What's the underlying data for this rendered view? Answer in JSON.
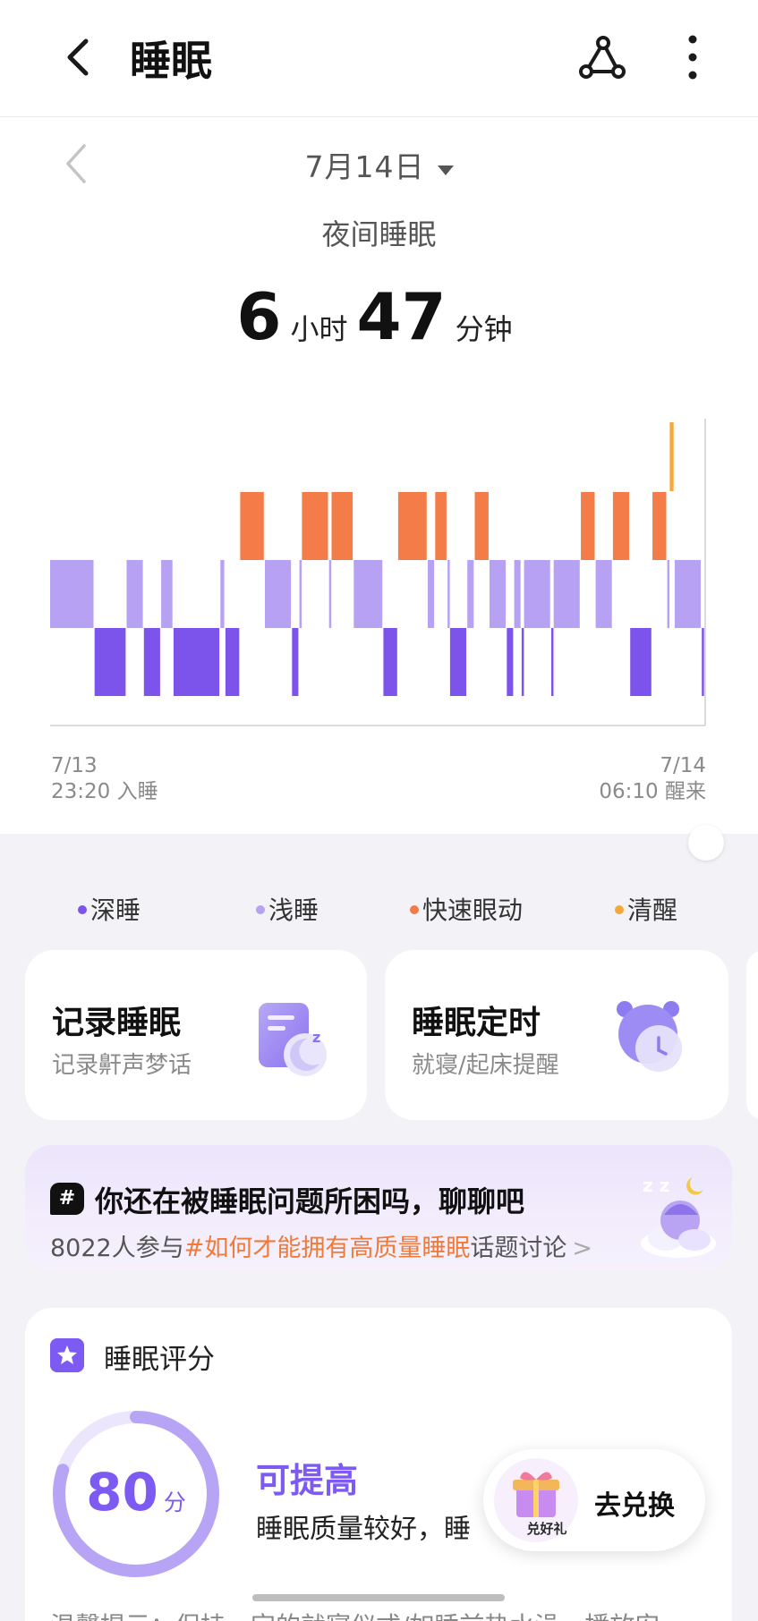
{
  "header": {
    "title": "睡眠",
    "back_icon": "back-arrow-icon",
    "share_icon": "share-icon",
    "more_icon": "more-vertical-icon"
  },
  "date": {
    "label": "7月14日",
    "prev_icon": "chevron-left-icon",
    "dropdown_icon": "caret-down-icon"
  },
  "summary": {
    "subtitle": "夜间睡眠",
    "hours": "6",
    "hours_unit": "小时",
    "minutes": "47",
    "minutes_unit": "分钟"
  },
  "chart_data": {
    "type": "hypnogram",
    "start": {
      "date": "7/13",
      "time_label": "23:20 入睡"
    },
    "end": {
      "date": "7/14",
      "time_label": "06:10 醒来"
    },
    "stages": [
      "awake",
      "rem",
      "light",
      "deep"
    ],
    "segments": [
      {
        "start": "23:20",
        "end": "23:38",
        "stage": "light"
      },
      {
        "start": "23:38",
        "end": "23:51",
        "stage": "deep"
      },
      {
        "start": "23:51",
        "end": "23:58",
        "stage": "light"
      },
      {
        "start": "23:58",
        "end": "00:05",
        "stage": "deep"
      },
      {
        "start": "00:05",
        "end": "00:10",
        "stage": "light"
      },
      {
        "start": "00:10",
        "end": "00:29",
        "stage": "deep"
      },
      {
        "start": "00:29",
        "end": "00:31",
        "stage": "light"
      },
      {
        "start": "00:31",
        "end": "00:37",
        "stage": "deep"
      },
      {
        "start": "00:37",
        "end": "00:47",
        "stage": "rem"
      },
      {
        "start": "00:47",
        "end": "00:58",
        "stage": "light"
      },
      {
        "start": "00:58",
        "end": "01:01",
        "stage": "deep"
      },
      {
        "start": "01:01",
        "end": "01:02",
        "stage": "light"
      },
      {
        "start": "01:02",
        "end": "01:13",
        "stage": "rem"
      },
      {
        "start": "01:13",
        "end": "01:14",
        "stage": "light"
      },
      {
        "start": "01:14",
        "end": "01:23",
        "stage": "rem"
      },
      {
        "start": "01:23",
        "end": "01:35",
        "stage": "light"
      },
      {
        "start": "01:35",
        "end": "01:41",
        "stage": "deep"
      },
      {
        "start": "01:41",
        "end": "01:53",
        "stage": "rem"
      },
      {
        "start": "01:53",
        "end": "01:56",
        "stage": "light"
      },
      {
        "start": "01:56",
        "end": "02:01",
        "stage": "rem"
      },
      {
        "start": "02:01",
        "end": "02:02",
        "stage": "light"
      },
      {
        "start": "02:02",
        "end": "02:09",
        "stage": "deep"
      },
      {
        "start": "02:09",
        "end": "02:12",
        "stage": "light"
      },
      {
        "start": "02:12",
        "end": "02:18",
        "stage": "rem"
      },
      {
        "start": "02:18",
        "end": "02:25",
        "stage": "light"
      },
      {
        "start": "02:25",
        "end": "02:28",
        "stage": "deep"
      },
      {
        "start": "02:28",
        "end": "02:31",
        "stage": "light"
      },
      {
        "start": "02:31",
        "end": "02:32",
        "stage": "deep"
      },
      {
        "start": "02:32",
        "end": "02:43",
        "stage": "light"
      },
      {
        "start": "02:43",
        "end": "02:44",
        "stage": "deep"
      },
      {
        "start": "02:44",
        "end": "02:55",
        "stage": "light"
      },
      {
        "start": "02:55",
        "end": "03:01",
        "stage": "rem"
      },
      {
        "start": "03:01",
        "end": "03:08",
        "stage": "light"
      },
      {
        "start": "03:08",
        "end": "03:15",
        "stage": "rem"
      },
      {
        "start": "03:15",
        "end": "03:24",
        "stage": "deep"
      },
      {
        "start": "03:24",
        "end": "03:30",
        "stage": "rem"
      },
      {
        "start": "03:30",
        "end": "03:31",
        "stage": "light"
      },
      {
        "start": "03:31",
        "end": "03:33",
        "stage": "awake"
      },
      {
        "start": "03:33",
        "end": "03:44",
        "stage": "light"
      },
      {
        "start": "03:44",
        "end": "03:45",
        "stage": "deep"
      }
    ]
  },
  "legend": [
    {
      "label": "深睡",
      "color": "#7d54eb"
    },
    {
      "label": "浅睡",
      "color": "#b6a1f2"
    },
    {
      "label": "快速眼动",
      "color": "#f47c48"
    },
    {
      "label": "清醒",
      "color": "#f3a83a"
    }
  ],
  "cards": [
    {
      "title": "记录睡眠",
      "subtitle": "记录鼾声梦话",
      "icon": "sleep-record-icon"
    },
    {
      "title": "睡眠定时",
      "subtitle": "就寝/起床提醒",
      "icon": "alarm-clock-icon"
    }
  ],
  "banner": {
    "hash_icon": "#",
    "title": "你还在被睡眠问题所困吗，聊聊吧",
    "desc_prefix": "8022人参与",
    "desc_highlight": "#如何才能拥有高质量睡眠",
    "desc_suffix": "话题讨论",
    "arrow": ">",
    "art_icon": "sleeping-moon-illustration",
    "accent_color": "#f07a3a"
  },
  "score": {
    "title": "睡眠评分",
    "value": "80",
    "value_fraction": 0.8,
    "unit": "分",
    "level": "可提高",
    "desc": "睡眠质量较好，睡",
    "accent_color": "#7d5bf2"
  },
  "float_button": {
    "label": "去兑换",
    "badge_text": "兑好礼",
    "icon": "gift-box-icon"
  },
  "footer": {
    "tip_text": "温馨提示：保持一定的就寝仪式/如睡前热水澡、播放安"
  }
}
